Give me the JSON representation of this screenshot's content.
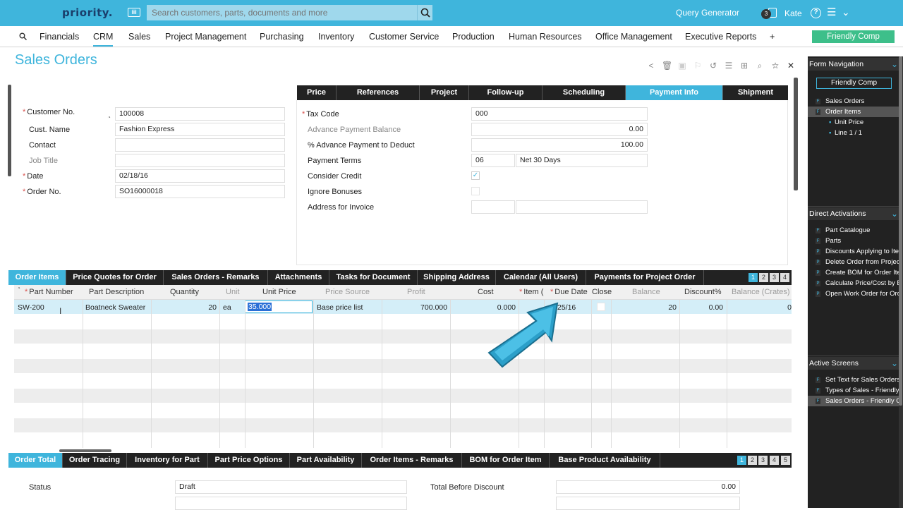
{
  "header": {
    "logo": "priority.",
    "search_placeholder": "Search customers, parts, documents and more",
    "query_generator": "Query Generator",
    "notification_count": "3",
    "user_name": "Kate"
  },
  "menu": {
    "items": [
      "Financials",
      "CRM",
      "Sales",
      "Project Management",
      "Purchasing",
      "Inventory",
      "Customer Service",
      "Production",
      "Human Resources",
      "Office Management",
      "Executive Reports",
      "+"
    ],
    "active": "CRM",
    "company": "Friendly Comp"
  },
  "page": {
    "title": "Sales Orders"
  },
  "left_form": {
    "customer_no_label": "Customer No.",
    "customer_no": "100008",
    "cust_name_label": "Cust. Name",
    "cust_name": "Fashion Express",
    "contact_label": "Contact",
    "contact": "",
    "job_title_label": "Job Title",
    "job_title": "",
    "date_label": "Date",
    "date": "02/18/16",
    "order_no_label": "Order No.",
    "order_no": "SO16000018"
  },
  "top_tabs": [
    "Price",
    "References",
    "Project",
    "Follow-up",
    "Scheduling",
    "Payment Info",
    "Shipment"
  ],
  "payment": {
    "tax_code_label": "Tax Code",
    "tax_code": "000",
    "adv_balance_label": "Advance Payment Balance",
    "adv_balance": "0.00",
    "adv_pct_label": "% Advance Payment to Deduct",
    "adv_pct": "100.00",
    "terms_label": "Payment Terms",
    "terms_code": "06",
    "terms_desc": "Net 30 Days",
    "consider_credit_label": "Consider Credit",
    "consider_credit_mark": "✓",
    "ignore_bonuses_label": "Ignore Bonuses",
    "address_label": "Address for Invoice"
  },
  "sub_tabs": [
    "Order Items",
    "Price Quotes for Order",
    "Sales Orders - Remarks",
    "Attachments",
    "Tasks for Document",
    "Shipping Address",
    "Calendar (All Users)",
    "Payments for Project Order"
  ],
  "sub_pages": [
    "1",
    "2",
    "3",
    "4"
  ],
  "grid": {
    "headers": [
      "Part Number",
      "Part Description",
      "Quantity",
      "Unit",
      "Unit Price",
      "Price Source",
      "Profit",
      "Cost",
      "Item (",
      "Due Date",
      "Close",
      "Balance",
      "Discount%",
      "Balance (Crates)"
    ],
    "row": {
      "part_number": "SW-200",
      "description": "Boatneck Sweater",
      "quantity": "20",
      "unit": "ea",
      "unit_price": "35.000",
      "price_source": "Base price list",
      "profit": "700.000",
      "cost": "0.000",
      "due_date": "25/16",
      "balance": "20",
      "discount": "0.00",
      "balance_crates": "0"
    }
  },
  "bottom_tabs": [
    "Order Total",
    "Order Tracing",
    "Inventory for Part",
    "Part Price Options",
    "Part Availability",
    "Order Items - Remarks",
    "BOM for Order Item",
    "Base Product Availability"
  ],
  "bottom_pages": [
    "1",
    "2",
    "3",
    "4",
    "5"
  ],
  "order_total": {
    "status_label": "Status",
    "status": "Draft",
    "before_discount_label": "Total Before Discount",
    "before_discount": "0.00"
  },
  "side": {
    "form_nav_title": "Form Navigation",
    "company": "Friendly Comp",
    "nav_items": [
      "Sales Orders",
      "Order Items"
    ],
    "nav_sub": [
      "Unit Price",
      "Line 1 / 1"
    ],
    "direct_title": "Direct Activations",
    "direct_items": [
      "Part Catalogue",
      "Parts",
      "Discounts Applying to Item",
      "Delete Order from Project",
      "Create BOM for Order Item",
      "Calculate Price/Cost by BOM",
      "Open Work Order for Order"
    ],
    "active_title": "Active Screens",
    "active_items": [
      "Set Text for Sales Orders - F",
      "Types of Sales - Friendly Comp",
      "Sales Orders - Friendly Comp"
    ]
  }
}
